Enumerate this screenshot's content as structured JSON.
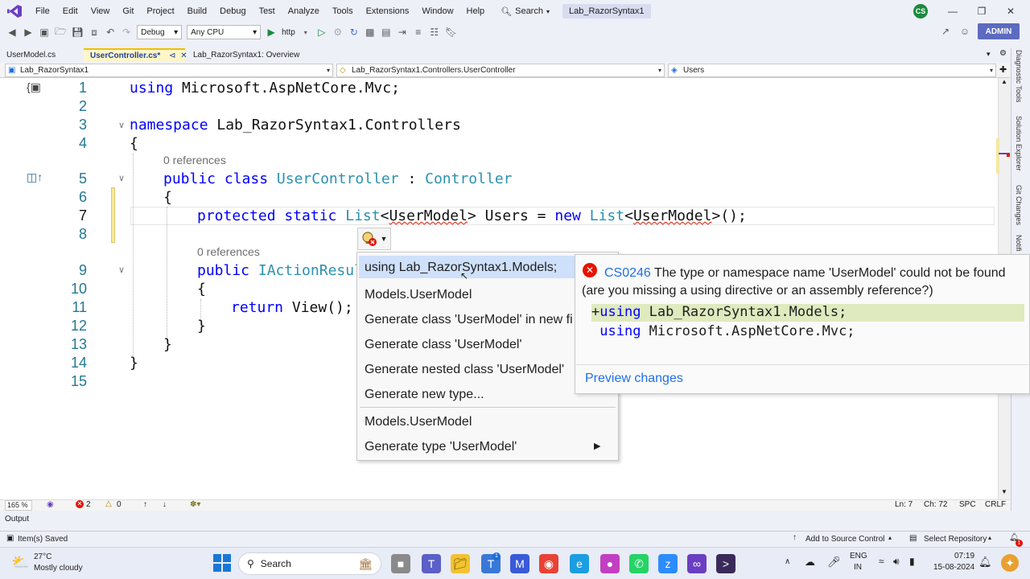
{
  "menubar": {
    "items": [
      "File",
      "Edit",
      "View",
      "Git",
      "Project",
      "Build",
      "Debug",
      "Test",
      "Analyze",
      "Tools",
      "Extensions",
      "Window",
      "Help"
    ],
    "search_label": "Search",
    "solution_title": "Lab_RazorSyntax1",
    "avatar_initials": "CS"
  },
  "toolbar": {
    "config": "Debug",
    "platform": "Any CPU",
    "run_target": "http",
    "account_badge": "ADMIN"
  },
  "tabs": [
    {
      "label": "UserModel.cs"
    },
    {
      "label": "UserController.cs*"
    },
    {
      "label": "Lab_RazorSyntax1: Overview"
    }
  ],
  "navbar": {
    "project": "Lab_RazorSyntax1",
    "class_path": "Lab_RazorSyntax1.Controllers.UserController",
    "member": "Users"
  },
  "editor": {
    "line_numbers": [
      "1",
      "2",
      "3",
      "4",
      "5",
      "6",
      "7",
      "8",
      "9",
      "10",
      "11",
      "12",
      "13",
      "14",
      "15"
    ],
    "code": {
      "l1_kw": "using",
      "l1_rest": " Microsoft.AspNetCore.Mvc;",
      "l3_kw": "namespace",
      "l3_rest": " Lab_RazorSyntax1.Controllers",
      "brace_open": "{",
      "brace_close": "}",
      "refs_a": "0 references",
      "l5_kw": "public class",
      "l5_type": "UserController",
      "l5_colon": " : ",
      "l5_base": "Controller",
      "l7_kw": "protected static",
      "l7_list": "List",
      "l7_lt": "<",
      "l7_model": "UserModel",
      "l7_gt": ">",
      "l7_users": " Users = ",
      "l7_new": "new",
      "l7_list2": "List",
      "l7_end": ">();",
      "refs_b": "0 references",
      "l9_kw": "public",
      "l9_type": "IActionResul",
      "l11_kw": "return",
      "l11_rest": " View();"
    }
  },
  "quick_actions": {
    "items": [
      "using Lab_RazorSyntax1.Models;",
      "Models.UserModel",
      "Generate class 'UserModel' in new fi",
      "Generate class 'UserModel'",
      "Generate nested class 'UserModel'",
      "Generate new type...",
      "Models.UserModel",
      "Generate type 'UserModel'"
    ]
  },
  "preview": {
    "error_code": "CS0246",
    "error_message": "The type or namespace name 'UserModel' could not be found (are you missing a using directive or an assembly reference?)",
    "diff_plus": "+",
    "diff_add_kw": "using",
    "diff_add_rest": " Lab_RazorSyntax1.Models;",
    "diff_keep_kw": "using",
    "diff_keep_rest": " Microsoft.AspNetCore.Mvc;",
    "link": "Preview changes"
  },
  "editor_status": {
    "zoom": "165 %",
    "errors": "2",
    "warnings": "0",
    "line": "Ln: 7",
    "col": "Ch: 72",
    "spacing": "SPC",
    "eol": "CRLF"
  },
  "output_label": "Output",
  "statusbar": {
    "saved": "Item(s) Saved",
    "source_control": "Add to Source Control",
    "repository": "Select Repository"
  },
  "right_tools": [
    "Diagnostic Tools",
    "Solution Explorer",
    "Git Changes",
    "Notifi"
  ],
  "taskbar": {
    "temp": "27°C",
    "weather": "Mostly cloudy",
    "search": "Search",
    "lang1": "ENG",
    "lang2": "IN",
    "time": "07:19",
    "date": "15-08-2024",
    "teams_badge": "1",
    "notif_badge": "1"
  },
  "colors": {
    "accent": "#5c6bc0",
    "keyword": "#0000ff",
    "type": "#2b91af",
    "error": "#e51400",
    "selection": "#cfe0fb"
  }
}
